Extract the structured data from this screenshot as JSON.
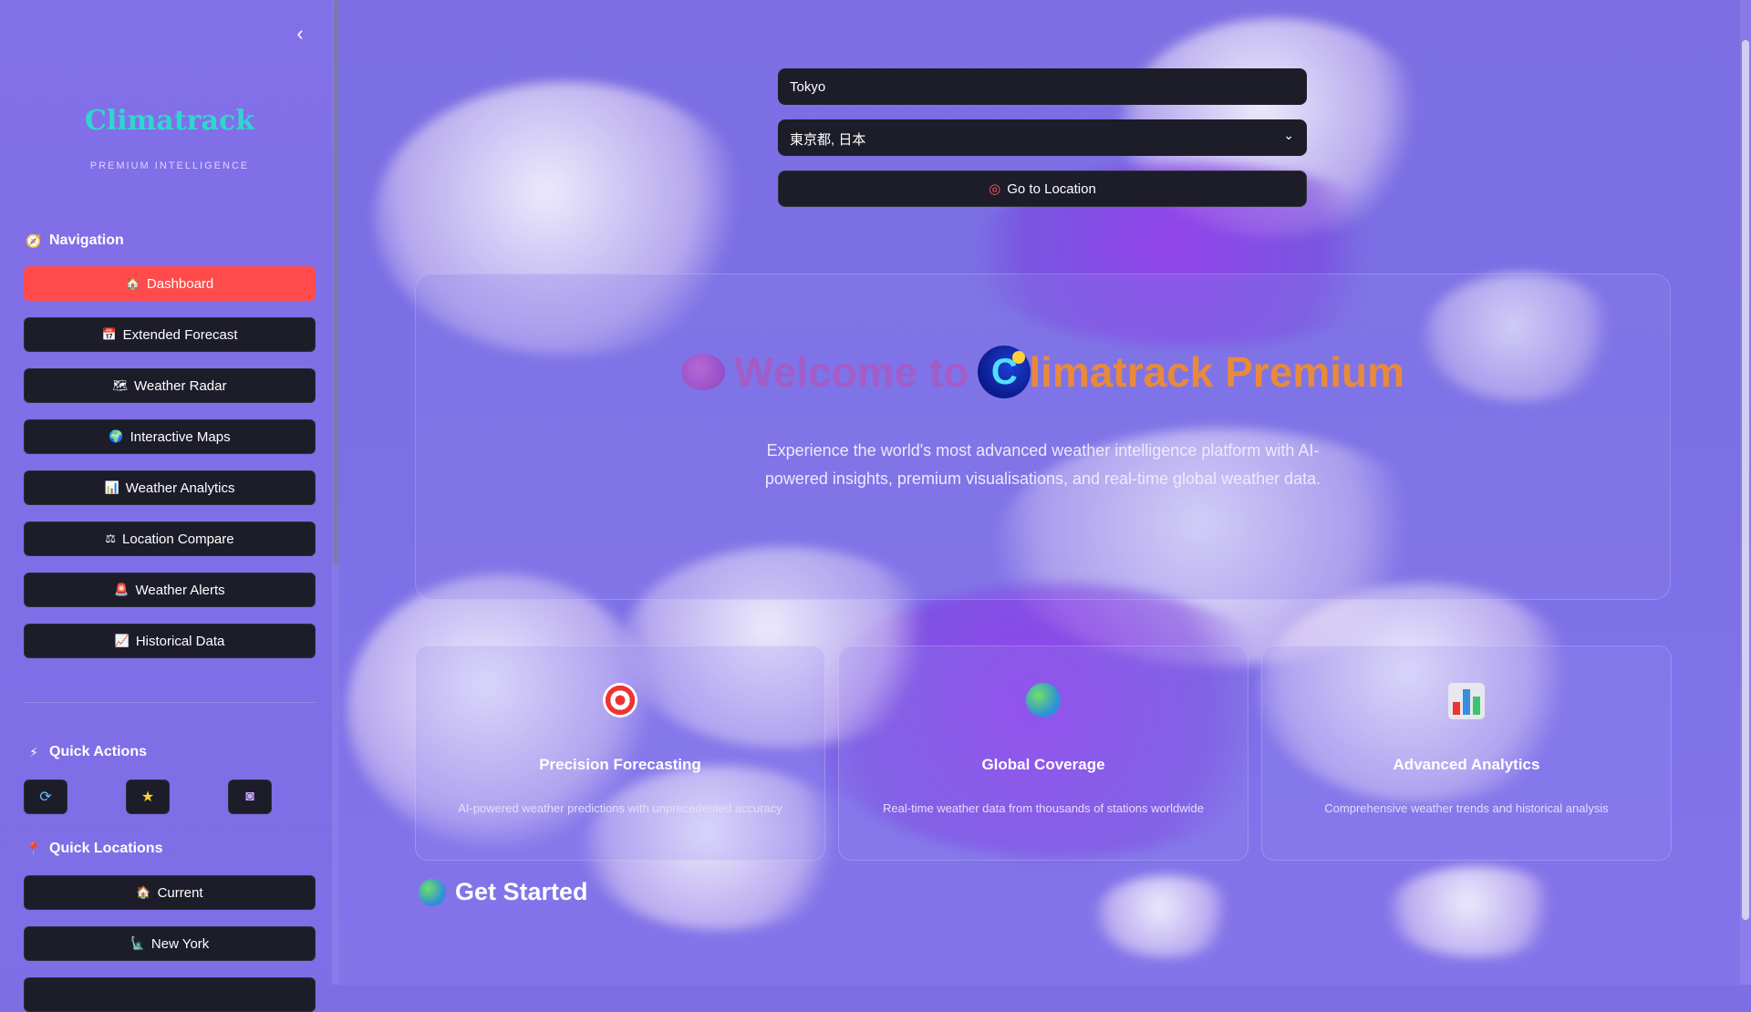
{
  "sidebar": {
    "collapse_icon": "chevron-left-icon",
    "brand": "Climatrack",
    "tagline": "PREMIUM INTELLIGENCE",
    "navigation_title": "Navigation",
    "nav_items": [
      {
        "label": "Dashboard",
        "icon": "house-icon",
        "active": true
      },
      {
        "label": "Extended Forecast",
        "icon": "calendar-icon"
      },
      {
        "label": "Weather Radar",
        "icon": "map-icon"
      },
      {
        "label": "Interactive Maps",
        "icon": "globe-icon"
      },
      {
        "label": "Weather Analytics",
        "icon": "bar-chart-icon"
      },
      {
        "label": "Location Compare",
        "icon": "scales-icon"
      },
      {
        "label": "Weather Alerts",
        "icon": "siren-icon"
      },
      {
        "label": "Historical Data",
        "icon": "line-chart-icon"
      }
    ],
    "quick_actions_title": "Quick Actions",
    "quick_actions": [
      {
        "icon": "refresh-icon",
        "glyph": "🔄"
      },
      {
        "icon": "star-icon",
        "glyph": "⭐"
      },
      {
        "icon": "camera-icon",
        "glyph": "📷"
      }
    ],
    "quick_locations_title": "Quick Locations",
    "quick_locations": [
      {
        "label": "Current",
        "icon": "home-icon"
      },
      {
        "label": "New York",
        "icon": "statue-of-liberty-icon"
      }
    ]
  },
  "search": {
    "city_value": "Tokyo",
    "location_select_value": "東京都, 日本",
    "go_button_label": "Go to Location"
  },
  "hero": {
    "title_welcome": "Welcome to",
    "title_brand": "limatrack Premium",
    "description": "Experience the world's most advanced weather intelligence platform with AI-powered insights, premium visualisations, and real-time global weather data."
  },
  "features": [
    {
      "title": "Precision Forecasting",
      "description": "AI-powered weather predictions with unprecedented accuracy",
      "icon": "target-icon"
    },
    {
      "title": "Global Coverage",
      "description": "Real-time weather data from thousands of stations worldwide",
      "icon": "globe-icon"
    },
    {
      "title": "Advanced Analytics",
      "description": "Comprehensive weather trends and historical analysis",
      "icon": "bar-chart-icon"
    }
  ],
  "get_started": {
    "title": "Get Started",
    "icon": "globe-icon"
  },
  "colors": {
    "active_nav": "#ff4b4b",
    "brand": "#2fd6d0",
    "button_bg": "#1c1d29",
    "welcome": "#a35cc8",
    "brand_orange": "#e98a3a"
  }
}
